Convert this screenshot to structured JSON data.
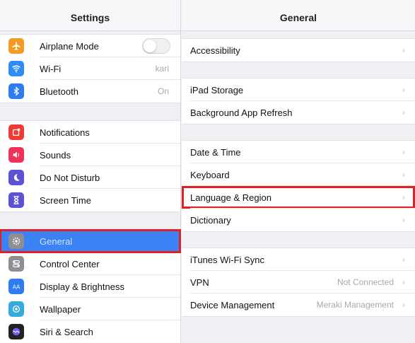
{
  "sidebar": {
    "title": "Settings",
    "groups": [
      [
        {
          "label": "Airplane Mode",
          "icon": "airplane-icon",
          "color": "#f59a23",
          "toggle": true
        },
        {
          "label": "Wi-Fi",
          "icon": "wifi-icon",
          "color": "#2f8cf5",
          "value": "kari"
        },
        {
          "label": "Bluetooth",
          "icon": "bluetooth-icon",
          "color": "#2f7cf0",
          "value": "On"
        }
      ],
      [
        {
          "label": "Notifications",
          "icon": "notifications-icon",
          "color": "#ef3b34"
        },
        {
          "label": "Sounds",
          "icon": "sounds-icon",
          "color": "#f0325a"
        },
        {
          "label": "Do Not Disturb",
          "icon": "moon-icon",
          "color": "#5b52d6"
        },
        {
          "label": "Screen Time",
          "icon": "hourglass-icon",
          "color": "#5b52d6"
        }
      ],
      [
        {
          "label": "General",
          "icon": "gear-icon",
          "color": "#8e8e93",
          "selected": true
        },
        {
          "label": "Control Center",
          "icon": "control-center-icon",
          "color": "#8e8e93"
        },
        {
          "label": "Display & Brightness",
          "icon": "display-icon",
          "color": "#2f7cf0"
        },
        {
          "label": "Wallpaper",
          "icon": "wallpaper-icon",
          "color": "#35aadc"
        },
        {
          "label": "Siri & Search",
          "icon": "siri-icon",
          "color": "#222"
        }
      ]
    ]
  },
  "detail": {
    "title": "General",
    "groups": [
      [
        {
          "label": "Accessibility"
        }
      ],
      [
        {
          "label": "iPad Storage"
        },
        {
          "label": "Background App Refresh"
        }
      ],
      [
        {
          "label": "Date & Time"
        },
        {
          "label": "Keyboard"
        },
        {
          "label": "Language & Region",
          "highlight": true
        },
        {
          "label": "Dictionary"
        }
      ],
      [
        {
          "label": "iTunes Wi-Fi Sync"
        },
        {
          "label": "VPN",
          "value": "Not Connected"
        },
        {
          "label": "Device Management",
          "value": "Meraki Management"
        }
      ]
    ]
  },
  "colors": {
    "selected_row": "#3b82f6",
    "highlight_outline": "#e02121"
  }
}
